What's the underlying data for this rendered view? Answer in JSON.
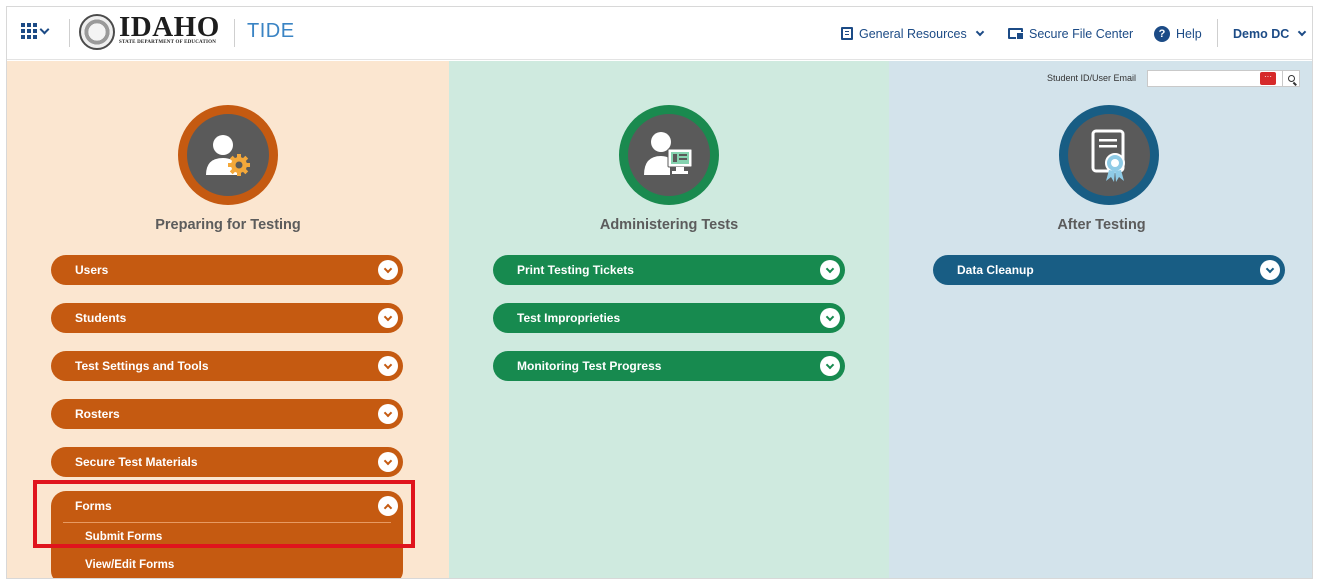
{
  "header": {
    "logo_main": "IDAHO",
    "logo_sub": "STATE DEPARTMENT OF EDUCATION",
    "app_name": "TIDE",
    "nav": {
      "general_resources": "General Resources",
      "secure_file_center": "Secure File Center",
      "help": "Help",
      "user": "Demo DC"
    }
  },
  "columns": {
    "preparing": {
      "title": "Preparing for Testing",
      "items": [
        "Users",
        "Students",
        "Test Settings and Tools",
        "Rosters",
        "Secure Test Materials"
      ],
      "forms": {
        "label": "Forms",
        "subitems": [
          "Submit Forms",
          "View/Edit Forms"
        ]
      }
    },
    "administering": {
      "title": "Administering Tests",
      "items": [
        "Print Testing Tickets",
        "Test Improprieties",
        "Monitoring Test Progress"
      ]
    },
    "after": {
      "title": "After Testing",
      "items": [
        "Data Cleanup"
      ],
      "search_label": "Student ID/User Email",
      "search_value": ""
    }
  },
  "colors": {
    "preparing": "#c55a11",
    "administering": "#178a4f",
    "after": "#185d84",
    "highlight": "#e0141d"
  },
  "icons": [
    "apps-grid-icon",
    "document-icon",
    "folder-icon",
    "help-icon",
    "user-gear-icon",
    "user-monitor-icon",
    "certificate-icon",
    "keyboard-icon",
    "search-icon"
  ]
}
